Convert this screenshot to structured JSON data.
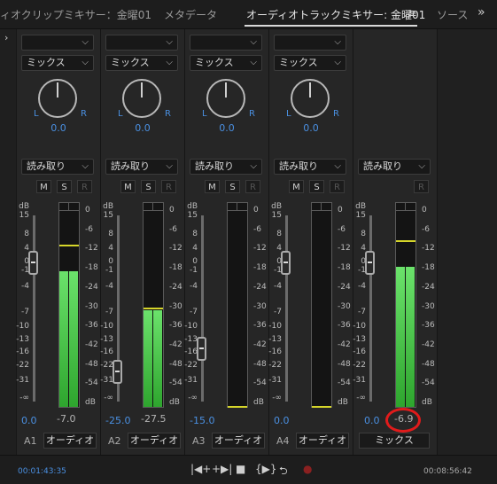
{
  "tabs": [
    "ィオクリップミキサー：金曜01",
    "メタデータ",
    "オーディオトラックミキサー: 金曜01",
    "ソース"
  ],
  "tab_menu_icon": "≡",
  "tab_more_icon": "»",
  "left_arrow": "›",
  "ui": {
    "mix_label": "ミックス",
    "read_label": "読み取り",
    "m": "M",
    "s": "S",
    "r": "R",
    "L": "L",
    "R": "R",
    "db": "dB",
    "scale_left": [
      "15",
      "8",
      "4",
      "0",
      "-1",
      "-4",
      "-7",
      "-10",
      "-13",
      "-16",
      "-22",
      "-31",
      "-∞"
    ],
    "scale_right": [
      "0",
      "-6",
      "-12",
      "-18",
      "-24",
      "-30",
      "-36",
      "-42",
      "-48",
      "-54",
      "dB"
    ]
  },
  "tracks": [
    {
      "id": "A1",
      "name": "オーディオ",
      "pan": "0.0",
      "volume": "0.0",
      "peak": "-7.0",
      "fader_db": 0,
      "meter_fill_pct": 0.69
    },
    {
      "id": "A2",
      "name": "オーディオ",
      "pan": "0.0",
      "volume": "-25.0",
      "peak": "-27.5",
      "fader_db": -25,
      "meter_fill_pct": 0.49
    },
    {
      "id": "A3",
      "name": "オーディオ",
      "pan": "0.0",
      "volume": "-15.0",
      "peak": "",
      "fader_db": -15,
      "meter_fill_pct": 0
    },
    {
      "id": "A4",
      "name": "オーディオ",
      "pan": "0.0",
      "volume": "0.0",
      "peak": "",
      "fader_db": 0,
      "meter_fill_pct": 0
    }
  ],
  "master": {
    "name": "ミックス",
    "volume": "0.0",
    "peak": "-6.9",
    "fader_db": 0,
    "meter_fill_pct": 0.71
  },
  "transport": {
    "current_time": "00:01:43:35",
    "duration": "00:08:56:42",
    "buttons": [
      "go-to-in",
      "go-to-out",
      "stop",
      "play-in-to-out",
      "loop",
      "record"
    ]
  },
  "colors": {
    "accent_blue": "#4a90e2",
    "meter_green": "#4fcf4f",
    "peak_yellow": "#d6d62a",
    "highlight_red": "#e11b1b"
  }
}
